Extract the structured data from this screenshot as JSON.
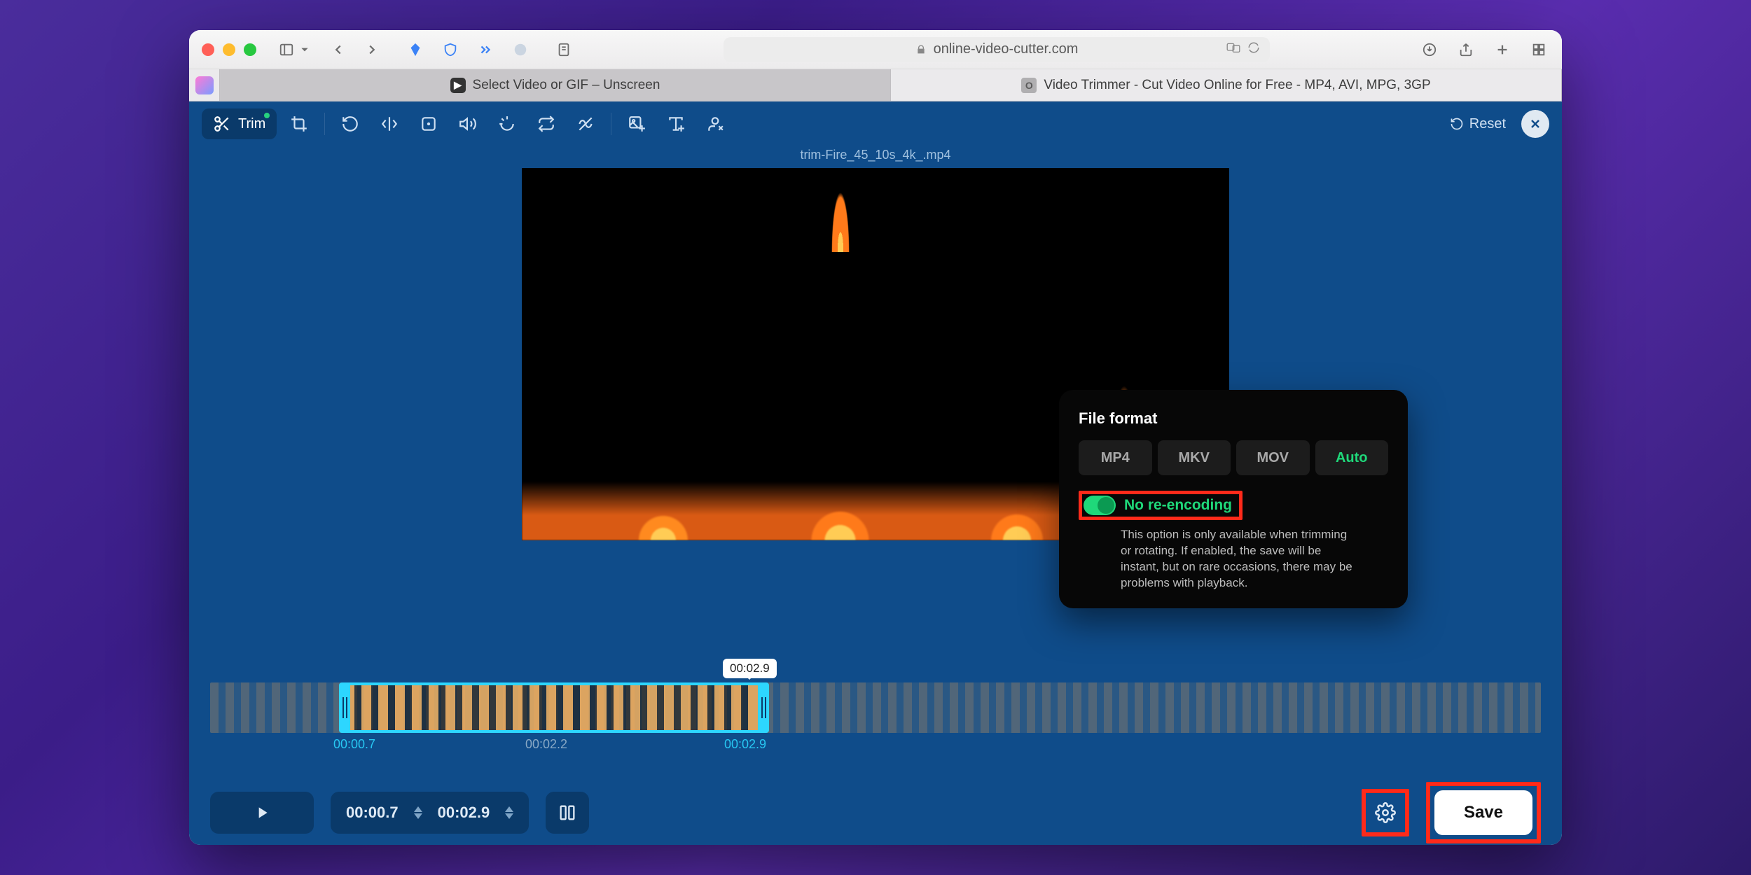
{
  "browser": {
    "url": "online-video-cutter.com",
    "tabs": [
      {
        "title": "Select Video or GIF – Unscreen"
      },
      {
        "title": "Video Trimmer - Cut Video Online for Free - MP4, AVI, MPG, 3GP"
      }
    ]
  },
  "toolbar": {
    "trim": "Trim",
    "reset": "Reset"
  },
  "filename": "trim-Fire_45_10s_4k_.mp4",
  "popup": {
    "title": "File format",
    "formats": [
      "MP4",
      "MKV",
      "MOV",
      "Auto"
    ],
    "selected_format": "Auto",
    "reencode_label": "No re-encoding",
    "reencode_enabled": true,
    "description": "This option is only available when trimming or rotating. If enabled, the save will be instant, but on rare occasions, there may be problems with playback."
  },
  "timeline": {
    "bubble": "00:02.9",
    "start_label": "00:00.7",
    "mid_label": "00:02.2",
    "end_label": "00:02.9"
  },
  "controls": {
    "start": "00:00.7",
    "end": "00:02.9",
    "save": "Save"
  }
}
